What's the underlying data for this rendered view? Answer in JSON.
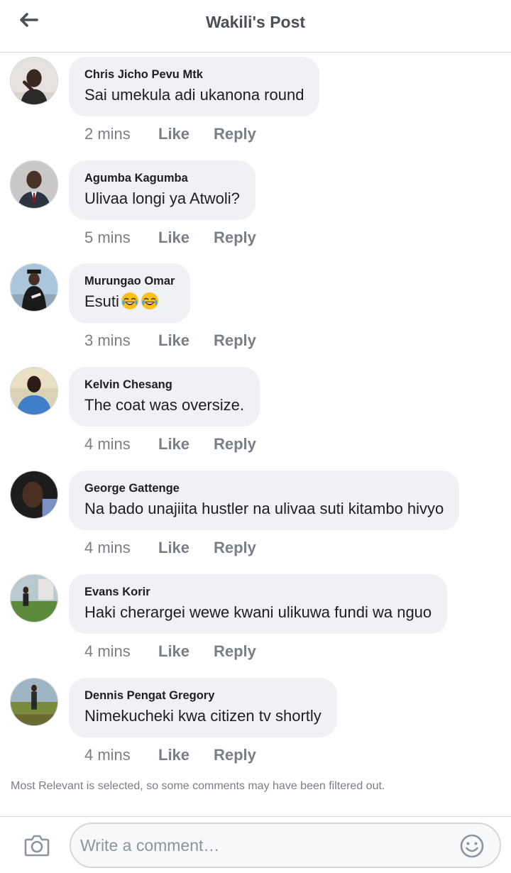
{
  "header": {
    "title": "Wakili's Post",
    "back_icon": "arrow-left-icon"
  },
  "comments": [
    {
      "author": "Chris Jicho Pevu Mtk",
      "text": "Sai umekula adi ukanona round",
      "time": "2 mins",
      "like": "Like",
      "reply": "Reply"
    },
    {
      "author": "Agumba Kagumba",
      "text": "Ulivaa longi ya Atwoli?",
      "time": "5 mins",
      "like": "Like",
      "reply": "Reply"
    },
    {
      "author": "Murungao Omar",
      "text": "Esuti",
      "emoji": [
        "face-with-tears-of-joy",
        "face-with-tears-of-joy"
      ],
      "time": "3 mins",
      "like": "Like",
      "reply": "Reply"
    },
    {
      "author": "Kelvin Chesang",
      "text": "The coat was oversize.",
      "time": "4 mins",
      "like": "Like",
      "reply": "Reply"
    },
    {
      "author": "George Gattenge",
      "text": "Na bado unajiita hustler na ulivaa suti kitambo hivyo",
      "time": "4 mins",
      "like": "Like",
      "reply": "Reply"
    },
    {
      "author": "Evans Korir",
      "text": "Haki cherargei wewe kwani ulikuwa fundi wa nguo",
      "time": "4 mins",
      "like": "Like",
      "reply": "Reply"
    },
    {
      "author": "Dennis Pengat Gregory",
      "text": "Nimekucheki kwa citizen tv shortly",
      "time": "4 mins",
      "like": "Like",
      "reply": "Reply"
    }
  ],
  "filter_note": "Most Relevant is selected, so some comments may have been filtered out.",
  "composer": {
    "placeholder": "Write a comment…",
    "camera_icon": "camera-icon",
    "emoji_icon": "smiley-icon"
  },
  "colors": {
    "bubble": "#eff1f4",
    "meta_text": "#7a7f87",
    "title": "#4b4f56",
    "divider": "#dadde1"
  }
}
